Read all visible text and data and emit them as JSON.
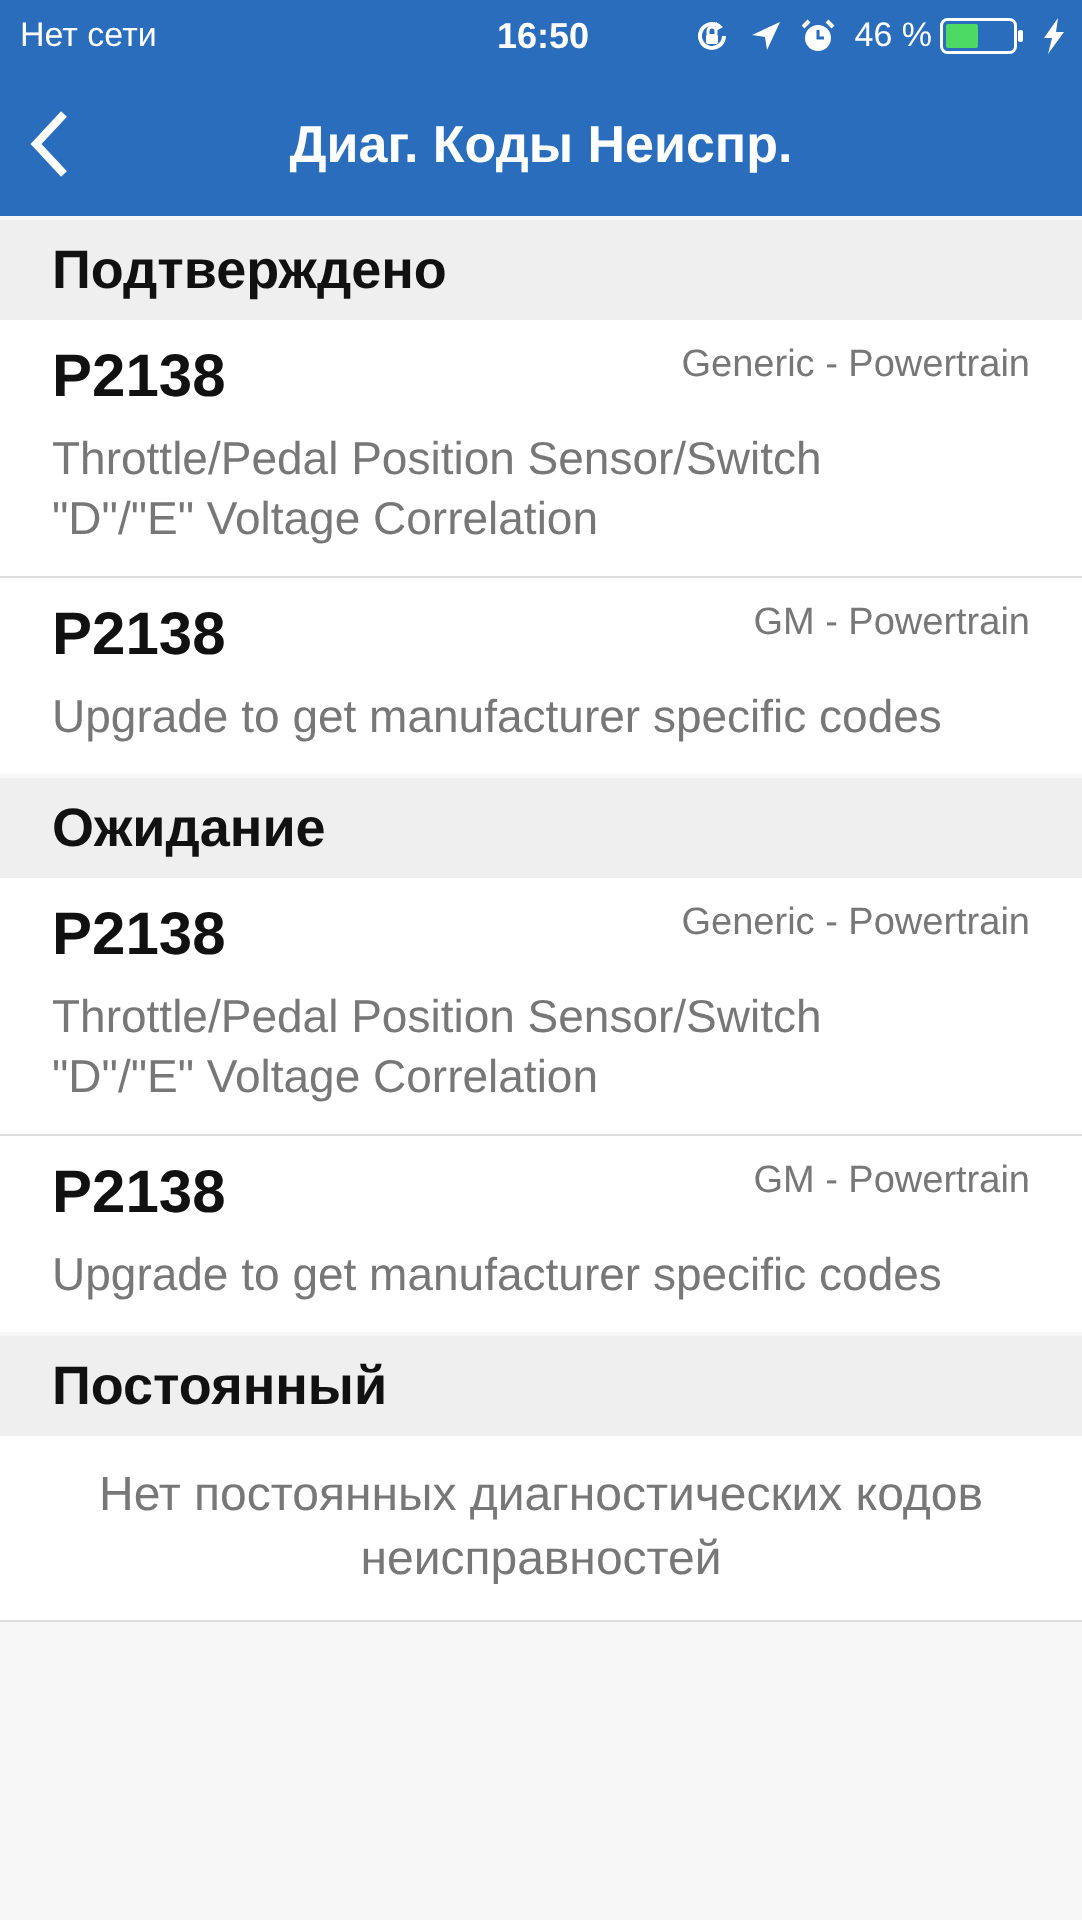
{
  "status_bar": {
    "carrier": "Нет сети",
    "time": "16:50",
    "battery": "46 %"
  },
  "nav": {
    "title": "Диаг. Коды Неиспр."
  },
  "sections": [
    {
      "title": "Подтверждено",
      "codes": [
        {
          "code": "P2138",
          "source": "Generic - Powertrain",
          "description": "Throttle/Pedal Position Sensor/Switch \"D\"/\"E\" Voltage Correlation"
        },
        {
          "code": "P2138",
          "source": "GM - Powertrain",
          "description": "Upgrade to get manufacturer specific codes"
        }
      ]
    },
    {
      "title": "Ожидание",
      "codes": [
        {
          "code": "P2138",
          "source": "Generic - Powertrain",
          "description": "Throttle/Pedal Position Sensor/Switch \"D\"/\"E\" Voltage Correlation"
        },
        {
          "code": "P2138",
          "source": "GM - Powertrain",
          "description": "Upgrade to get manufacturer specific codes"
        }
      ]
    },
    {
      "title": "Постоянный",
      "empty_message": "Нет постоянных диагностических кодов неисправностей"
    }
  ]
}
